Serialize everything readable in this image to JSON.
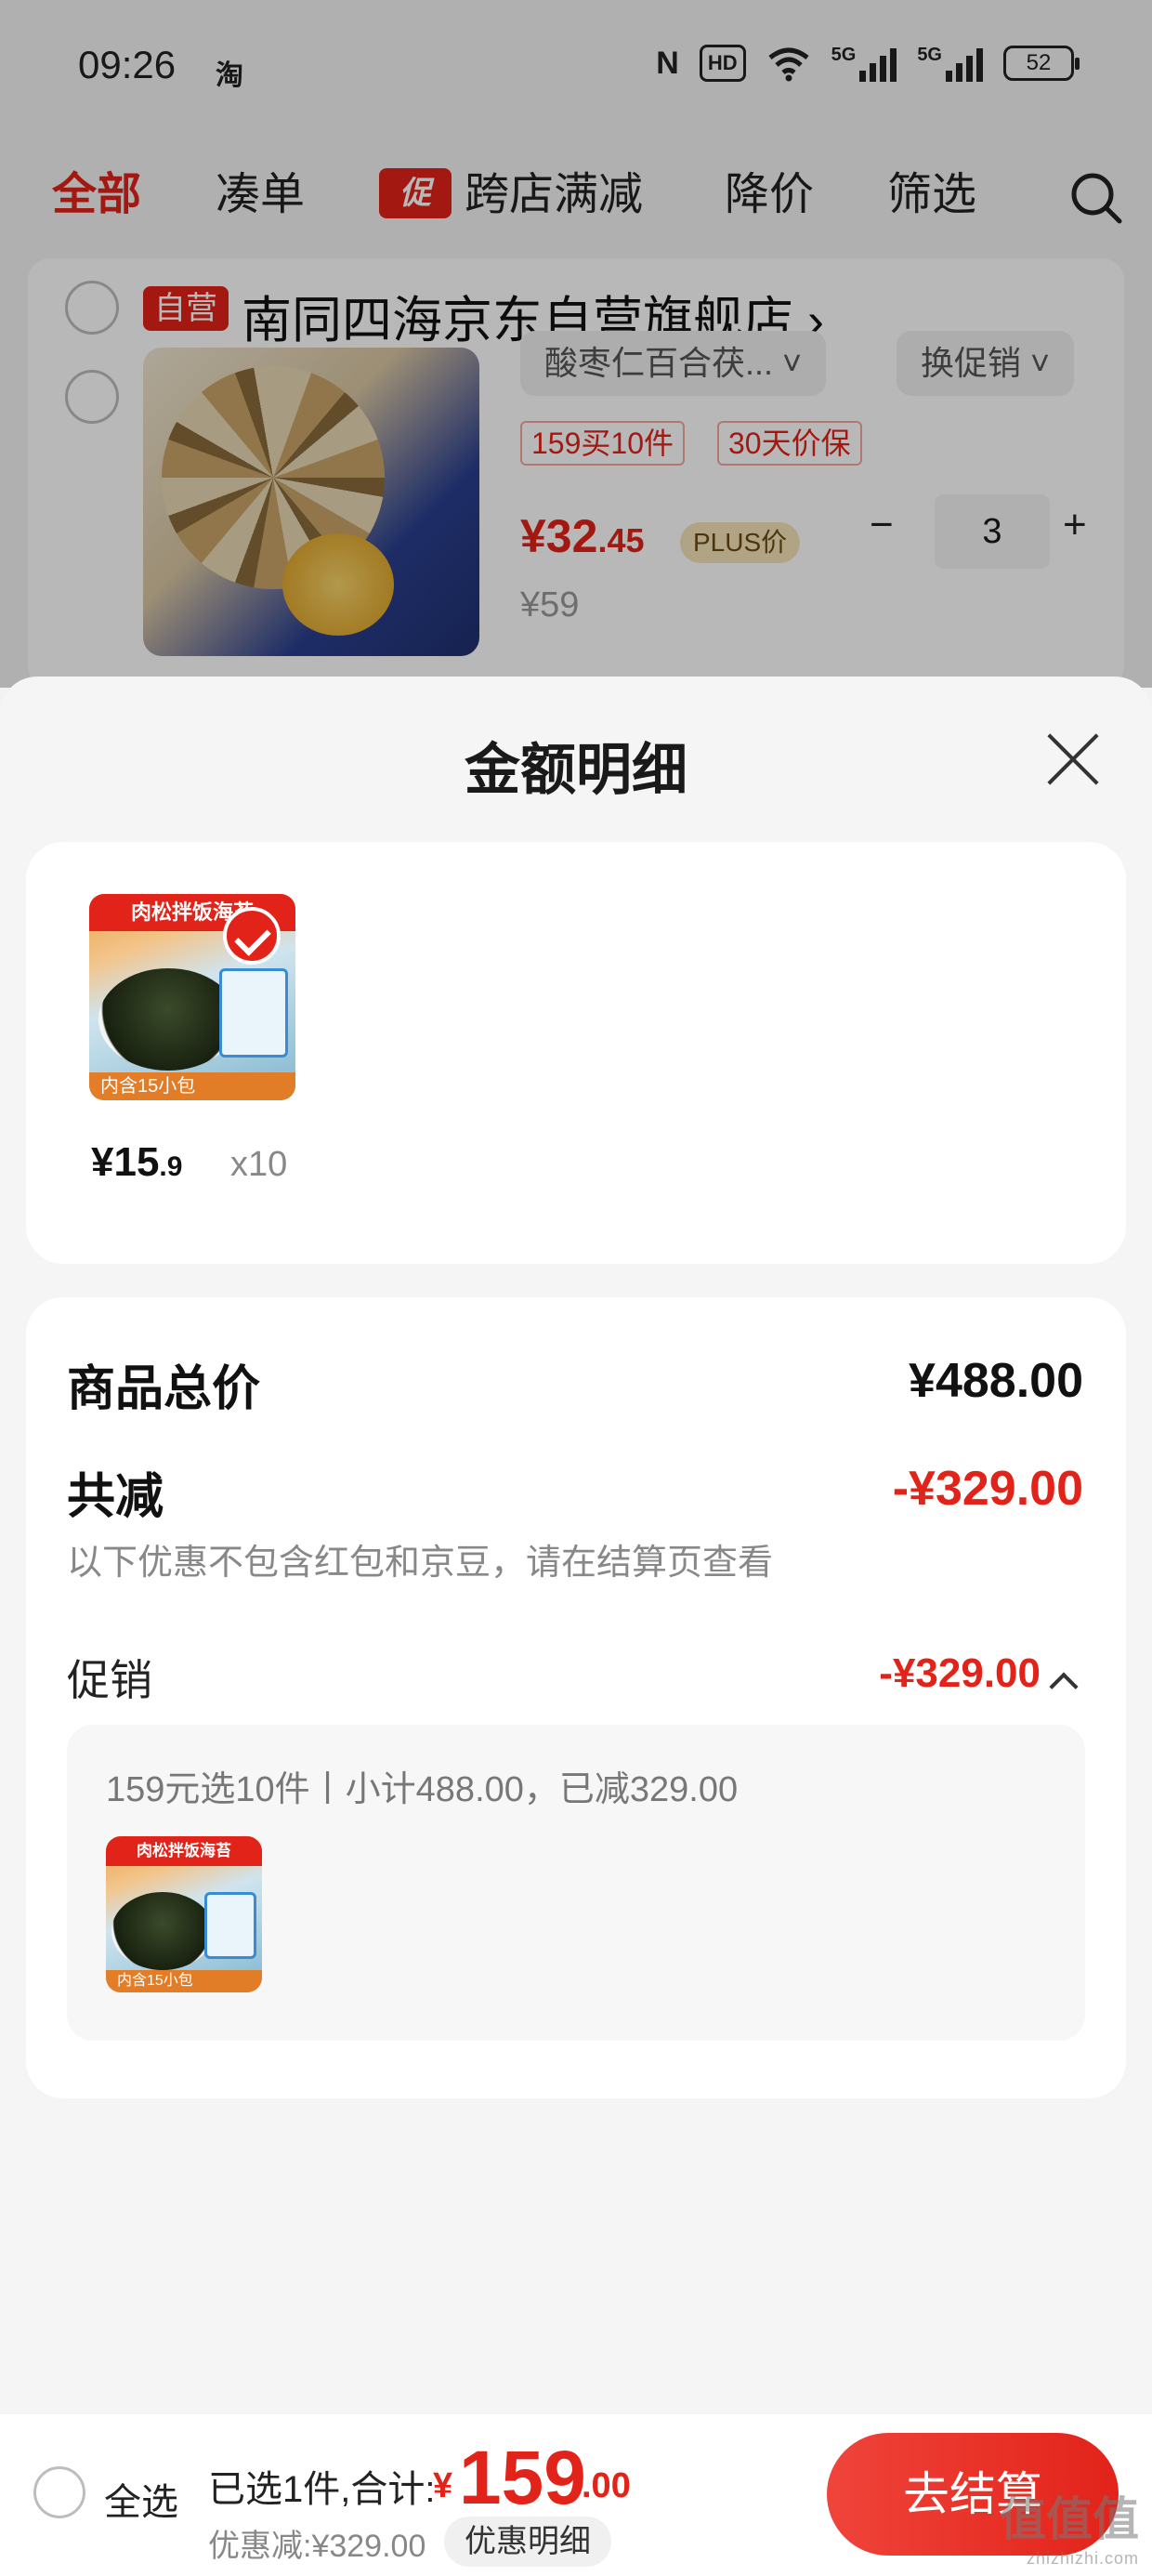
{
  "status_bar": {
    "time": "09:26",
    "app_icon": "淘",
    "hd": "HD",
    "network1": "5G",
    "network2": "5G",
    "battery": "52"
  },
  "top_tabs": {
    "all": "全部",
    "bundle": "凑单",
    "promo_badge": "促",
    "cross_store": "跨店满减",
    "price_drop": "降价",
    "filter": "筛选"
  },
  "store": {
    "self_tag": "自营",
    "name": "南同四海京东自营旗舰店 ›",
    "variant": "酸枣仁百合茯... ˅",
    "promo_select": "换促销 ˅",
    "chips": [
      "159买10件",
      "30天价保"
    ],
    "price_int": "¥32",
    "price_dec": ".45",
    "plus_tag": "PLUS价",
    "qty": "3",
    "minus": "−",
    "plus": "+",
    "original_price": "¥59"
  },
  "sheet": {
    "title": "金额明细",
    "item": {
      "thumb_top": "肉松拌饭海苔",
      "thumb_bottom": "内含15小包",
      "price_int": "¥15",
      "price_dec": ".9",
      "qty": "x10"
    },
    "summary": {
      "total_label": "商品总价",
      "total_value": "¥488.00",
      "discount_label": "共减",
      "discount_value": "-¥329.00",
      "note": "以下优惠不包含红包和京豆，请在结算页查看",
      "promo_label": "促销",
      "promo_value": "-¥329.00",
      "promo_desc": "159元选10件丨小计488.00，已减329.00",
      "promo_thumb_top": "肉松拌饭海苔",
      "promo_thumb_bottom": "内含15小包"
    }
  },
  "bottom_bar": {
    "select_all": "全选",
    "summary": "已选1件,合计:",
    "currency": "¥",
    "total_int": "159",
    "total_dec": ".00",
    "discount": "优惠减:¥329.00",
    "detail_button": "优惠明细",
    "checkout": "去结算"
  },
  "watermark": {
    "main": "值值值",
    "sub": "zhizhizhi.com"
  },
  "colors": {
    "accent_red": "#e2231a",
    "background": "#f5f5f5"
  }
}
